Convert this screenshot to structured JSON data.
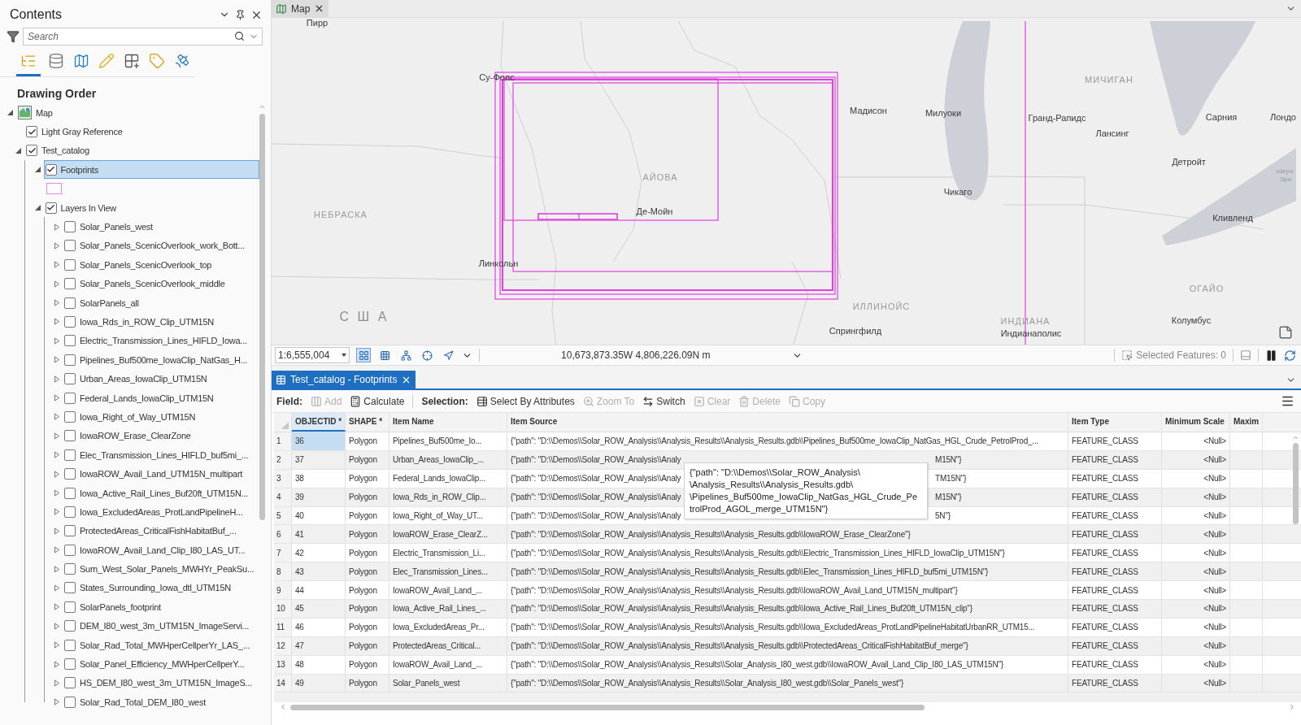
{
  "contents": {
    "title": "Contents",
    "search": {
      "placeholder": "Search"
    },
    "views": [
      {
        "kind": "drawing-order",
        "selected": true
      },
      {
        "kind": "data-source",
        "selected": false
      },
      {
        "kind": "selection",
        "selected": false
      },
      {
        "kind": "editing",
        "selected": false
      },
      {
        "kind": "snapping",
        "selected": false
      },
      {
        "kind": "labeling",
        "selected": false
      },
      {
        "kind": "imagery",
        "selected": false
      }
    ],
    "heading": "Drawing Order",
    "tree": [
      {
        "label": "Map",
        "kind": "map",
        "expanded": true,
        "selected": false,
        "children": [
          {
            "label": "Light Gray Reference",
            "kind": "layer",
            "checked": true,
            "selected": false
          },
          {
            "label": "Test_catalog",
            "kind": "group",
            "checked": true,
            "expanded": true,
            "selected": false,
            "children": [
              {
                "label": "Footprints",
                "kind": "polygon-layer",
                "checked": true,
                "expanded": true,
                "selected": true
              },
              {
                "label": "Layers In View",
                "kind": "group",
                "checked": true,
                "expanded": true,
                "selected": false,
                "children": [
                  {
                    "label": "Solar_Panels_west",
                    "kind": "layer",
                    "checked": false,
                    "expanded": false,
                    "selected": false
                  },
                  {
                    "label": "Solar_Panels_ScenicOverlook_work_Bott...",
                    "kind": "layer",
                    "checked": false,
                    "expanded": false,
                    "selected": false
                  },
                  {
                    "label": "Solar_Panels_ScenicOverlook_top",
                    "kind": "layer",
                    "checked": false,
                    "expanded": false,
                    "selected": false
                  },
                  {
                    "label": "Solar_Panels_ScenicOverlook_middle",
                    "kind": "layer",
                    "checked": false,
                    "expanded": false,
                    "selected": false
                  },
                  {
                    "label": "SolarPanels_all",
                    "kind": "layer",
                    "checked": false,
                    "expanded": false,
                    "selected": false
                  },
                  {
                    "label": "Iowa_Rds_in_ROW_Clip_UTM15N",
                    "kind": "layer",
                    "checked": false,
                    "expanded": false,
                    "selected": false
                  },
                  {
                    "label": "Electric_Transmission_Lines_HIFLD_Iowa...",
                    "kind": "layer",
                    "checked": false,
                    "expanded": false,
                    "selected": false
                  },
                  {
                    "label": "Pipelines_Buf500me_IowaClip_NatGas_H...",
                    "kind": "layer",
                    "checked": false,
                    "expanded": false,
                    "selected": false
                  },
                  {
                    "label": "Urban_Areas_IowaClip_UTM15N",
                    "kind": "layer",
                    "checked": false,
                    "expanded": false,
                    "selected": false
                  },
                  {
                    "label": "Federal_Lands_IowaClip_UTM15N",
                    "kind": "layer",
                    "checked": false,
                    "expanded": false,
                    "selected": false
                  },
                  {
                    "label": "Iowa_Right_of_Way_UTM15N",
                    "kind": "layer",
                    "checked": false,
                    "expanded": false,
                    "selected": false
                  },
                  {
                    "label": "IowaROW_Erase_ClearZone",
                    "kind": "layer",
                    "checked": false,
                    "expanded": false,
                    "selected": false
                  },
                  {
                    "label": "Elec_Transmission_Lines_HIFLD_buf5mi_...",
                    "kind": "layer",
                    "checked": false,
                    "expanded": false,
                    "selected": false
                  },
                  {
                    "label": "IowaROW_Avail_Land_UTM15N_multipart",
                    "kind": "layer",
                    "checked": false,
                    "expanded": false,
                    "selected": false
                  },
                  {
                    "label": "Iowa_Active_Rail_Lines_Buf20ft_UTM15N...",
                    "kind": "layer",
                    "checked": false,
                    "expanded": false,
                    "selected": false
                  },
                  {
                    "label": "Iowa_ExcludedAreas_ProtLandPipelineH...",
                    "kind": "layer",
                    "checked": false,
                    "expanded": false,
                    "selected": false
                  },
                  {
                    "label": "ProtectedAreas_CriticalFishHabitatBuf_...",
                    "kind": "layer",
                    "checked": false,
                    "expanded": false,
                    "selected": false
                  },
                  {
                    "label": "IowaROW_Avail_Land_Clip_I80_LAS_UT...",
                    "kind": "layer",
                    "checked": false,
                    "expanded": false,
                    "selected": false
                  },
                  {
                    "label": "Sum_West_Solar_Panels_MWHYr_PeakSu...",
                    "kind": "layer",
                    "checked": false,
                    "expanded": false,
                    "selected": false
                  },
                  {
                    "label": "States_Surrounding_Iowa_dtl_UTM15N",
                    "kind": "layer",
                    "checked": false,
                    "expanded": false,
                    "selected": false
                  },
                  {
                    "label": "SolarPanels_footprint",
                    "kind": "layer",
                    "checked": false,
                    "expanded": false,
                    "selected": false
                  },
                  {
                    "label": "DEM_I80_west_3m_UTM15N_ImageServi...",
                    "kind": "layer",
                    "checked": false,
                    "expanded": false,
                    "selected": false
                  },
                  {
                    "label": "Solar_Rad_Total_MWHperCellperYr_LAS_...",
                    "kind": "layer",
                    "checked": false,
                    "expanded": false,
                    "selected": false
                  },
                  {
                    "label": "Solar_Panel_Efficiency_MWHperCellperY...",
                    "kind": "layer",
                    "checked": false,
                    "expanded": false,
                    "selected": false
                  },
                  {
                    "label": "HS_DEM_I80_west_3m_UTM15N_ImageS...",
                    "kind": "layer",
                    "checked": false,
                    "expanded": false,
                    "selected": false
                  },
                  {
                    "label": "Solar_Rad_Total_DEM_I80_west",
                    "kind": "layer",
                    "checked": false,
                    "expanded": false,
                    "selected": false
                  }
                ]
              }
            ]
          }
        ]
      }
    ]
  },
  "map": {
    "tab": {
      "title": "Map"
    },
    "labels": [
      {
        "text": "Пирр",
        "kind": "city"
      },
      {
        "text": "Су-Фолс",
        "kind": "city"
      },
      {
        "text": "МИЧИГАН",
        "kind": "region"
      },
      {
        "text": "Мадисон",
        "kind": "city"
      },
      {
        "text": "Милуоки",
        "kind": "city"
      },
      {
        "text": "Гранд-Рапидс",
        "kind": "city"
      },
      {
        "text": "Сарния",
        "kind": "city"
      },
      {
        "text": "Лондо",
        "kind": "city"
      },
      {
        "text": "Лансинг",
        "kind": "city"
      },
      {
        "text": "Детройт",
        "kind": "city"
      },
      {
        "text": "АЙОВА",
        "kind": "region"
      },
      {
        "text": "озеро",
        "kind": "water"
      },
      {
        "text": "Эри",
        "kind": "water"
      },
      {
        "text": "Чикаго",
        "kind": "city"
      },
      {
        "text": "НЕБРАСКА",
        "kind": "region"
      },
      {
        "text": "Де-Мойн",
        "kind": "city"
      },
      {
        "text": "Кливленд",
        "kind": "city"
      },
      {
        "text": "Линкольн",
        "kind": "city"
      },
      {
        "text": "ОГАЙО",
        "kind": "region"
      },
      {
        "text": "ИЛЛИНОЙС",
        "kind": "region"
      },
      {
        "text": "С Ш А",
        "kind": "country"
      },
      {
        "text": "ИНДИАНА",
        "kind": "region"
      },
      {
        "text": "Колумбус",
        "kind": "city"
      },
      {
        "text": "Спрингфилд",
        "kind": "city"
      },
      {
        "text": "Индианаполис",
        "kind": "city"
      }
    ],
    "scale": "1:6,555,004",
    "nav_tools": [
      {
        "kind": "snap-grid",
        "selected": true
      },
      {
        "kind": "grid",
        "selected": false
      },
      {
        "kind": "network",
        "selected": false
      },
      {
        "kind": "crosshair",
        "selected": false
      },
      {
        "kind": "north",
        "selected": false
      }
    ],
    "coordinates": "10,673,873.35W 4,806,226.09N m",
    "selected_features": "Selected Features: 0"
  },
  "table": {
    "tab": "Test_catalog - Footprints",
    "field_label": "Field:",
    "field_tools": [
      {
        "label": "Add",
        "kind": "add",
        "disabled": true
      },
      {
        "label": "Calculate",
        "kind": "calculate",
        "disabled": false
      }
    ],
    "selection_label": "Selection:",
    "selection_tools": [
      {
        "label": "Select By Attributes",
        "kind": "select",
        "disabled": false
      },
      {
        "label": "Zoom To",
        "kind": "zoom",
        "disabled": true
      },
      {
        "label": "Switch",
        "kind": "switch",
        "disabled": false
      },
      {
        "label": "Clear",
        "kind": "clear",
        "disabled": true
      },
      {
        "label": "Delete",
        "kind": "delete",
        "disabled": true
      },
      {
        "label": "Copy",
        "kind": "copy",
        "disabled": true
      }
    ],
    "columns": [
      {
        "label": "OBJECTID *",
        "selected": true
      },
      {
        "label": "SHAPE *",
        "selected": false
      },
      {
        "label": "Item Name",
        "selected": false
      },
      {
        "label": "Item Source",
        "selected": false
      },
      {
        "label": "Item Type",
        "selected": false
      },
      {
        "label": "Minimum Scale",
        "selected": false
      },
      {
        "label": "Maxim",
        "selected": false
      }
    ],
    "rows": [
      {
        "number": "1",
        "objectid": "36",
        "shape": "Polygon",
        "item_name": "Pipelines_Buf500me_Io...",
        "item_source": "{\"path\": \"D:\\\\Demos\\\\Solar_ROW_Analysis\\\\Analysis_Results\\\\Analysis_Results.gdb\\\\Pipelines_Buf500me_IowaClip_NatGas_HGL_Crude_PetrolProd_...",
        "item_type": "FEATURE_CLASS",
        "min_scale": "<Null>",
        "selected": true
      },
      {
        "number": "2",
        "objectid": "37",
        "shape": "Polygon",
        "item_name": "Urban_Areas_IowaClip_...",
        "item_source": "{\"path\": \"D:\\\\Demos\\\\Solar_ROW_Analysis\\\\Analy",
        "item_source_end": "M15N\"}",
        "item_type": "FEATURE_CLASS",
        "min_scale": "<Null>",
        "selected": false
      },
      {
        "number": "3",
        "objectid": "38",
        "shape": "Polygon",
        "item_name": "Federal_Lands_IowaClip...",
        "item_source": "{\"path\": \"D:\\\\Demos\\\\Solar_ROW_Analysis\\\\Analy",
        "item_source_end": "TM15N\"}",
        "item_type": "FEATURE_CLASS",
        "min_scale": "<Null>",
        "selected": false
      },
      {
        "number": "4",
        "objectid": "39",
        "shape": "Polygon",
        "item_name": "Iowa_Rds_in_ROW_Clip...",
        "item_source": "{\"path\": \"D:\\\\Demos\\\\Solar_ROW_Analysis\\\\Analy",
        "item_source_end": "M15N\"}",
        "item_type": "FEATURE_CLASS",
        "min_scale": "<Null>",
        "selected": false
      },
      {
        "number": "5",
        "objectid": "40",
        "shape": "Polygon",
        "item_name": "Iowa_Right_of_Way_UT...",
        "item_source": "{\"path\": \"D:\\\\Demos\\\\Solar_ROW_Analysis\\\\Analy",
        "item_source_end": "5N\"}",
        "item_type": "FEATURE_CLASS",
        "min_scale": "<Null>",
        "selected": false
      },
      {
        "number": "6",
        "objectid": "41",
        "shape": "Polygon",
        "item_name": "IowaROW_Erase_ClearZ...",
        "item_source": "{\"path\": \"D:\\\\Demos\\\\Solar_ROW_Analysis\\\\Analysis_Results\\\\Analysis_Results.gdb\\\\IowaROW_Erase_ClearZone\"}",
        "item_type": "FEATURE_CLASS",
        "min_scale": "<Null>",
        "selected": false
      },
      {
        "number": "7",
        "objectid": "42",
        "shape": "Polygon",
        "item_name": "Electric_Transmission_Li...",
        "item_source": "{\"path\": \"D:\\\\Demos\\\\Solar_ROW_Analysis\\\\Analysis_Results\\\\Analysis_Results.gdb\\\\Electric_Transmission_Lines_HIFLD_IowaClip_UTM15N\"}",
        "item_type": "FEATURE_CLASS",
        "min_scale": "<Null>",
        "selected": false
      },
      {
        "number": "8",
        "objectid": "43",
        "shape": "Polygon",
        "item_name": "Elec_Transmission_Lines...",
        "item_source": "{\"path\": \"D:\\\\Demos\\\\Solar_ROW_Analysis\\\\Analysis_Results\\\\Analysis_Results.gdb\\\\Elec_Transmission_Lines_HIFLD_buf5mi_UTM15N\"}",
        "item_type": "FEATURE_CLASS",
        "min_scale": "<Null>",
        "selected": false
      },
      {
        "number": "9",
        "objectid": "44",
        "shape": "Polygon",
        "item_name": "IowaROW_Avail_Land_...",
        "item_source": "{\"path\": \"D:\\\\Demos\\\\Solar_ROW_Analysis\\\\Analysis_Results\\\\Analysis_Results.gdb\\\\IowaROW_Avail_Land_UTM15N_multipart\"}",
        "item_type": "FEATURE_CLASS",
        "min_scale": "<Null>",
        "selected": false
      },
      {
        "number": "10",
        "objectid": "45",
        "shape": "Polygon",
        "item_name": "Iowa_Active_Rail_Lines_...",
        "item_source": "{\"path\": \"D:\\\\Demos\\\\Solar_ROW_Analysis\\\\Analysis_Results\\\\Analysis_Results.gdb\\\\Iowa_Active_Rail_Lines_Buf20ft_UTM15N_clip\"}",
        "item_type": "FEATURE_CLASS",
        "min_scale": "<Null>",
        "selected": false
      },
      {
        "number": "11",
        "objectid": "46",
        "shape": "Polygon",
        "item_name": "Iowa_ExcludedAreas_Pr...",
        "item_source": "{\"path\": \"D:\\\\Demos\\\\Solar_ROW_Analysis\\\\Analysis_Results\\\\Analysis_Results.gdb\\\\Iowa_ExcludedAreas_ProtLandPipelineHabitatUrbanRR_UTM15...",
        "item_type": "FEATURE_CLASS",
        "min_scale": "<Null>",
        "selected": false
      },
      {
        "number": "12",
        "objectid": "47",
        "shape": "Polygon",
        "item_name": "ProtectedAreas_Critical...",
        "item_source": "{\"path\": \"D:\\\\Demos\\\\Solar_ROW_Analysis\\\\Analysis_Results\\\\Analysis_Results.gdb\\\\ProtectedAreas_CriticalFishHabitatBuf_merge\"}",
        "item_type": "FEATURE_CLASS",
        "min_scale": "<Null>",
        "selected": false
      },
      {
        "number": "13",
        "objectid": "48",
        "shape": "Polygon",
        "item_name": "IowaROW_Avail_Land_...",
        "item_source": "{\"path\": \"D:\\\\Demos\\\\Solar_ROW_Analysis\\\\Analysis_Results\\\\Solar_Analysis_I80_west.gdb\\\\IowaROW_Avail_Land_Clip_I80_LAS_UTM15N\"}",
        "item_type": "FEATURE_CLASS",
        "min_scale": "<Null>",
        "selected": false
      },
      {
        "number": "14",
        "objectid": "49",
        "shape": "Polygon",
        "item_name": "Solar_Panels_west",
        "item_source": "{\"path\": \"D:\\\\Demos\\\\Solar_ROW_Analysis\\\\Analysis_Results\\\\Solar_Analysis_I80_west.gdb\\\\Solar_Panels_west\"}",
        "item_type": "FEATURE_CLASS",
        "min_scale": "<Null>",
        "selected": false
      }
    ],
    "tooltip": {
      "lines": [
        "{\"path\": \"D:\\\\Demos\\\\Solar_ROW_Analysis\\",
        "\\Analysis_Results\\\\Analysis_Results.gdb\\",
        "\\Pipelines_Buf500me_IowaClip_NatGas_HGL_Crude_Pe",
        "trolProd_AGOL_merge_UTM15N\"}"
      ]
    }
  }
}
